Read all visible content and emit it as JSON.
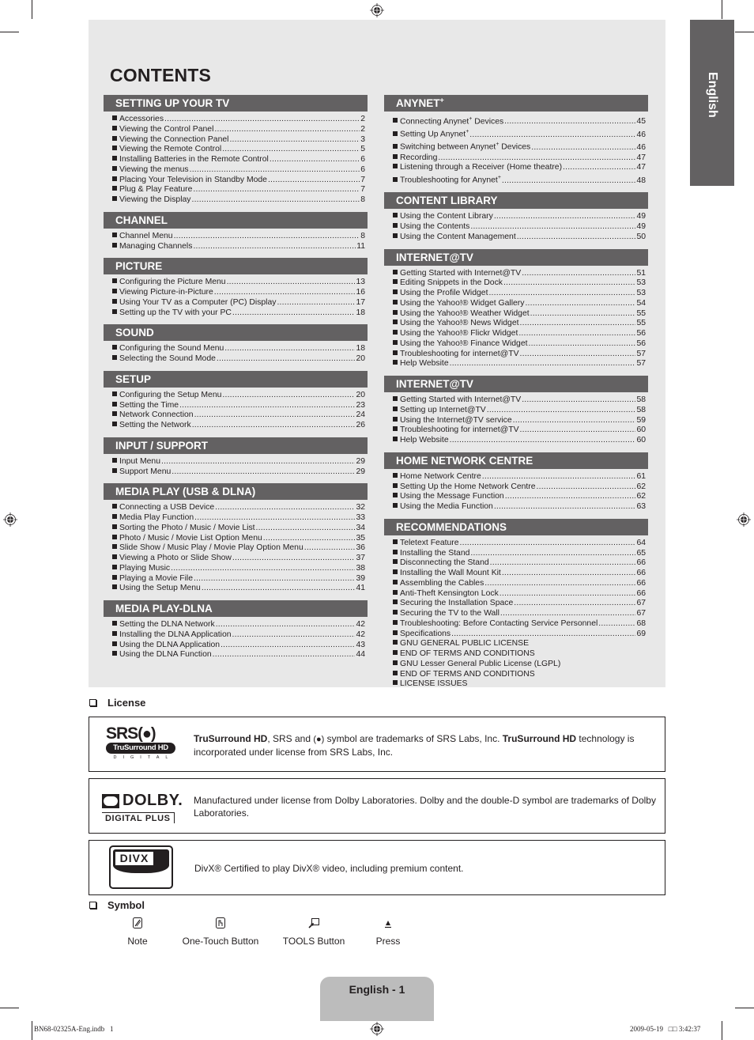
{
  "language_tab": "English",
  "contents_title": "CONTENTS",
  "left_column": [
    {
      "title": "SETTING UP YOUR TV",
      "items": [
        {
          "label": "Accessories",
          "page": "2"
        },
        {
          "label": "Viewing the Control Panel",
          "page": "2"
        },
        {
          "label": "Viewing the Connection Panel",
          "page": "3"
        },
        {
          "label": "Viewing the Remote Control",
          "page": "5"
        },
        {
          "label": "Installing Batteries in the Remote Control",
          "page": "6"
        },
        {
          "label": "Viewing the menus",
          "page": "6"
        },
        {
          "label": "Placing Your Television in Standby Mode",
          "page": "7"
        },
        {
          "label": "Plug & Play Feature",
          "page": "7"
        },
        {
          "label": "Viewing the Display",
          "page": "8"
        }
      ]
    },
    {
      "title": "CHANNEL",
      "items": [
        {
          "label": "Channel Menu",
          "page": "8"
        },
        {
          "label": "Managing Channels",
          "page": "11"
        }
      ]
    },
    {
      "title": "PICTURE",
      "items": [
        {
          "label": "Configuring the Picture Menu",
          "page": "13"
        },
        {
          "label": "Viewing Picture-in-Picture",
          "page": "16"
        },
        {
          "label": "Using Your TV as a Computer (PC) Display",
          "page": "17"
        },
        {
          "label": "Setting up the TV with your PC",
          "page": "18"
        }
      ]
    },
    {
      "title": "SOUND",
      "items": [
        {
          "label": "Configuring the Sound Menu",
          "page": "18"
        },
        {
          "label": "Selecting the Sound Mode",
          "page": "20"
        }
      ]
    },
    {
      "title": "SETUP",
      "items": [
        {
          "label": "Configuring the Setup Menu",
          "page": "20"
        },
        {
          "label": "Setting the Time",
          "page": "23"
        },
        {
          "label": "Network Connection",
          "page": "24"
        },
        {
          "label": "Setting the Network",
          "page": "26"
        }
      ]
    },
    {
      "title": "INPUT / SUPPORT",
      "items": [
        {
          "label": "Input Menu",
          "page": "29"
        },
        {
          "label": "Support Menu",
          "page": "29"
        }
      ]
    },
    {
      "title": "MEDIA PLAY (USB & DLNA)",
      "items": [
        {
          "label": "Connecting a USB Device",
          "page": "32"
        },
        {
          "label": "Media Play Function",
          "page": "33"
        },
        {
          "label": "Sorting the Photo / Music / Movie List",
          "page": "34"
        },
        {
          "label": "Photo / Music / Movie List Option Menu",
          "page": "35"
        },
        {
          "label": "Slide Show / Music Play / Movie Play Option Menu",
          "page": "36"
        },
        {
          "label": "Viewing a Photo or Slide Show",
          "page": "37"
        },
        {
          "label": "Playing Music",
          "page": "38"
        },
        {
          "label": "Playing a Movie File",
          "page": "39"
        },
        {
          "label": "Using the Setup Menu",
          "page": "41"
        }
      ]
    },
    {
      "title": "MEDIA PLAY-DLNA",
      "items": [
        {
          "label": "Setting the DLNA Network",
          "page": "42"
        },
        {
          "label": "Installing the DLNA Application",
          "page": "42"
        },
        {
          "label": "Using the DLNA Application",
          "page": "43"
        },
        {
          "label": "Using the DLNA Function",
          "page": "44"
        }
      ]
    }
  ],
  "right_column": [
    {
      "title": "ANYNET",
      "title_sup": "+",
      "items": [
        {
          "label": "Connecting Anynet",
          "sup": "+",
          "label_after": " Devices",
          "page": "45"
        },
        {
          "label": "Setting Up Anynet",
          "sup": "+",
          "label_after": "",
          "page": "46"
        },
        {
          "label": "Switching between Anynet",
          "sup": "+",
          "label_after": " Devices",
          "page": "46"
        },
        {
          "label": "Recording",
          "page": "47"
        },
        {
          "label": "Listening through a Receiver (Home theatre)",
          "page": "47"
        },
        {
          "label": "Troubleshooting for Anynet",
          "sup": "+",
          "label_after": "",
          "page": "48"
        }
      ]
    },
    {
      "title": "CONTENT LIBRARY",
      "items": [
        {
          "label": "Using the Content Library",
          "page": "49"
        },
        {
          "label": "Using the Contents",
          "page": "49"
        },
        {
          "label": "Using the Content Management",
          "page": "50"
        }
      ]
    },
    {
      "title": "INTERNET@TV",
      "items": [
        {
          "label": "Getting Started with Internet@TV",
          "page": "51"
        },
        {
          "label": "Editing Snippets in the Dock",
          "page": "53"
        },
        {
          "label": "Using the Profile Widget",
          "page": "53"
        },
        {
          "label": "Using the Yahoo!® Widget Gallery",
          "page": "54"
        },
        {
          "label": "Using the Yahoo!® Weather Widget",
          "page": "55"
        },
        {
          "label": "Using the Yahoo!® News Widget",
          "page": "55"
        },
        {
          "label": "Using the Yahoo!® Flickr Widget",
          "page": "56"
        },
        {
          "label": "Using the Yahoo!® Finance Widget",
          "page": "56"
        },
        {
          "label": "Troubleshooting for internet@TV",
          "page": "57"
        },
        {
          "label": "Help Website",
          "page": "57"
        }
      ]
    },
    {
      "title": "INTERNET@TV",
      "items": [
        {
          "label": "Getting Started with Internet@TV",
          "page": "58"
        },
        {
          "label": "Setting up Internet@TV",
          "page": "58"
        },
        {
          "label": "Using the Internet@TV service",
          "page": "59"
        },
        {
          "label": "Troubleshooting for internet@TV",
          "page": "60"
        },
        {
          "label": "Help Website",
          "page": "60"
        }
      ]
    },
    {
      "title": "HOME NETWORK CENTRE",
      "items": [
        {
          "label": "Home Network Centre",
          "page": "61"
        },
        {
          "label": "Setting Up the Home Network Centre",
          "page": "62"
        },
        {
          "label": "Using the Message Function",
          "page": "62"
        },
        {
          "label": "Using the Media Function",
          "page": "63"
        }
      ]
    },
    {
      "title": "RECOMMENDATIONS",
      "items": [
        {
          "label": "Teletext Feature",
          "page": "64"
        },
        {
          "label": "Installing the Stand",
          "page": "65"
        },
        {
          "label": "Disconnecting the Stand",
          "page": "66"
        },
        {
          "label": "Installing the Wall Mount Kit",
          "page": "66"
        },
        {
          "label": "Assembling the Cables",
          "page": "66"
        },
        {
          "label": "Anti-Theft Kensington Lock",
          "page": "66"
        },
        {
          "label": "Securing the Installation Space",
          "page": "67"
        },
        {
          "label": "Securing the TV to the Wall",
          "page": "67"
        },
        {
          "label": "Troubleshooting: Before Contacting Service Personnel",
          "page": "68"
        },
        {
          "label": "Specifications",
          "page": "69"
        },
        {
          "label": "GNU GENERAL PUBLIC LICENSE",
          "page": null
        },
        {
          "label": "END OF TERMS AND CONDITIONS",
          "page": null
        },
        {
          "label": "GNU Lesser General Public License (LGPL)",
          "page": null
        },
        {
          "label": "END OF TERMS AND CONDITIONS",
          "page": null
        },
        {
          "label": "LICENSE ISSUES",
          "page": null
        }
      ]
    }
  ],
  "license": {
    "heading": "License",
    "srs": {
      "logo_top": "SRS",
      "logo_pill": "TruSurround HD",
      "logo_bottom": "DIGITAL",
      "bold1": "TruSurround HD",
      "text1": ", SRS and ",
      "text2": " symbol are trademarks of SRS Labs, Inc. ",
      "bold2": "TruSurround HD",
      "text3": " technology is incorporated under license from SRS Labs, Inc."
    },
    "dolby": {
      "logo_word": "DOLBY.",
      "logo_sub": "DIGITAL PLUS",
      "text": "Manufactured under license from Dolby Laboratories. Dolby and the double-D symbol are trademarks of Dolby Laboratories."
    },
    "divx": {
      "logo_word": "DIVX",
      "text": "DivX® Certified to play DivX® video, including premium content."
    }
  },
  "symbol": {
    "heading": "Symbol",
    "items": [
      {
        "icon": "note-icon",
        "label": "Note"
      },
      {
        "icon": "one-touch-button-icon",
        "label": "One-Touch Button"
      },
      {
        "icon": "tools-button-icon",
        "label": "TOOLS Button"
      },
      {
        "icon": "press-icon",
        "label": "Press"
      }
    ]
  },
  "footer": {
    "page_label": "English - 1",
    "file_info": "BN68-02325A-Eng.indb   1",
    "timestamp": "2009-05-19   □□ 3:42:37"
  },
  "colors": {
    "panel_bg": "#e8e8e8",
    "section_header": "#636162",
    "page_tab": "#bcbcbc",
    "text": "#231f20"
  }
}
